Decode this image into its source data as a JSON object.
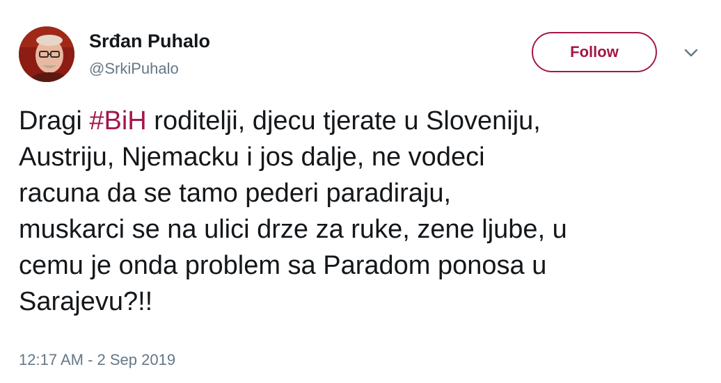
{
  "author": {
    "display_name": "Srđan Puhalo",
    "handle": "@SrkiPuhalo"
  },
  "follow_button": {
    "label": "Follow"
  },
  "menu_icon": "chevron-down-icon",
  "tweet": {
    "line1_before": "Dragi ",
    "hashtag": "#BiH",
    "line1_after": " roditelji, djecu tjerate u Sloveniju,",
    "line2": "Austriju, Njemacku i jos dalje, ne vodeci",
    "line3": "racuna da se tamo pederi paradiraju,",
    "line4": "muskarci se na ulici drze za ruke, zene ljube, u",
    "line5": "cemu je onda problem sa Paradom ponosa u",
    "line6": "Sarajevu?!!"
  },
  "timestamp": "12:17 AM - 2 Sep 2019",
  "colors": {
    "accent": "#a3174a",
    "text": "#14171a",
    "secondary_text": "#657786"
  }
}
